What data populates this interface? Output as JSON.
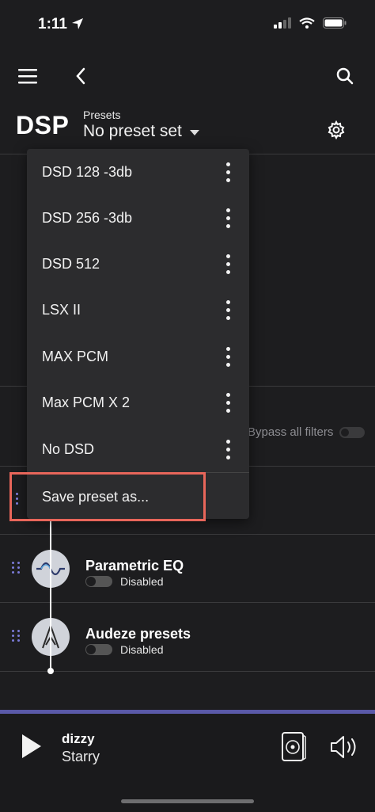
{
  "status": {
    "time": "1:11"
  },
  "header": {
    "title": "DSP",
    "presets_label": "Presets",
    "preset_value": "No preset set"
  },
  "dropdown": {
    "items": [
      {
        "label": "DSD 128 -3db"
      },
      {
        "label": "DSD 256 -3db"
      },
      {
        "label": "DSD 512"
      },
      {
        "label": "LSX II"
      },
      {
        "label": "MAX PCM"
      },
      {
        "label": "Max PCM X 2"
      },
      {
        "label": "No DSD"
      }
    ],
    "save_label": "Save preset as..."
  },
  "bypass": {
    "label": "Bypass all filters"
  },
  "filters": [
    {
      "name": "Parametric EQ",
      "status": "Disabled"
    },
    {
      "name": "Audeze presets",
      "status": "Disabled"
    }
  ],
  "player": {
    "title": "dizzy",
    "artist": "Starry"
  },
  "colors": {
    "background": "#1d1d1f",
    "menu_bg": "#2c2c2e",
    "accent": "#5a59a8",
    "highlight": "#e8665a"
  }
}
